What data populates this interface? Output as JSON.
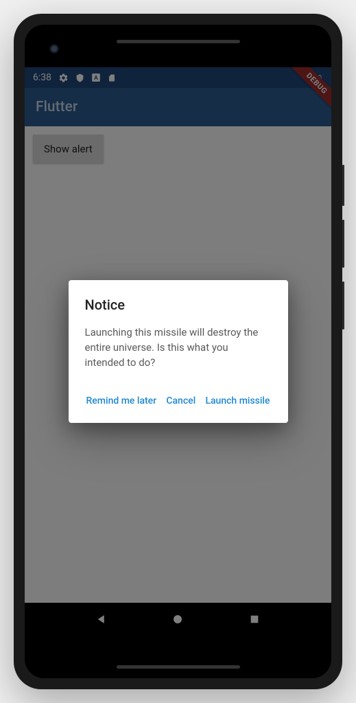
{
  "status_bar": {
    "time": "6:38"
  },
  "app_bar": {
    "title": "Flutter"
  },
  "debug_label": "DEBUG",
  "main": {
    "show_alert_label": "Show alert"
  },
  "dialog": {
    "title": "Notice",
    "body": "Launching this missile will destroy the entire universe. Is this what you intended to do?",
    "actions": {
      "remind": "Remind me later",
      "cancel": "Cancel",
      "launch": "Launch missile"
    }
  }
}
